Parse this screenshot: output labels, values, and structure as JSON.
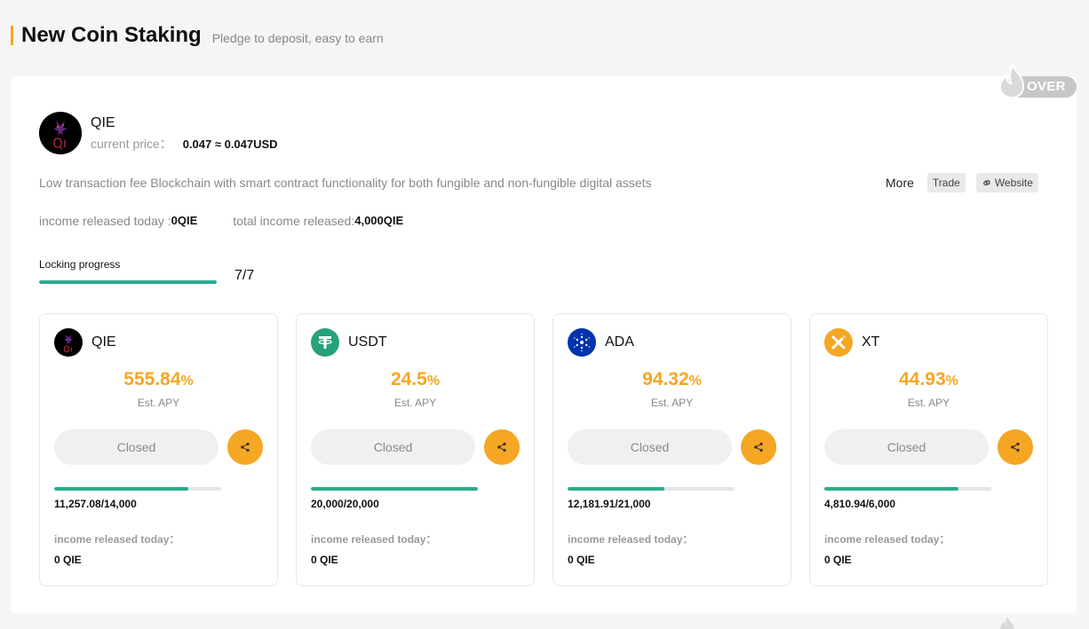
{
  "header": {
    "title": "New Coin Staking",
    "subtitle": "Pledge to deposit, easy to earn",
    "accent_color": "#f5a623"
  },
  "badge": {
    "label": "OVER",
    "icon": "flame-icon"
  },
  "coin": {
    "name": "QIE",
    "price_label": "current price：",
    "price_value": "0.047 ≈ 0.047USD",
    "description": "Low transaction fee Blockchain with smart contract functionality for both fungible and non-fungible digital assets",
    "more_label": "More",
    "trade_label": "Trade",
    "website_label": "Website",
    "income_today_label": "income released today : ",
    "income_today_value": "0QIE",
    "total_income_label": "total income released: ",
    "total_income_value": "4,000QIE"
  },
  "locking": {
    "label": "Locking progress",
    "count": "7/7",
    "progress": 1.0,
    "progress_color": "#2bab8d"
  },
  "pools": [
    {
      "name": "QIE",
      "apy": "555.84",
      "apy_unit": "%",
      "apy_label": "Est. APY",
      "button_label": "Closed",
      "progress": 0.804,
      "progress_text": "11,257.08/14,000",
      "income_label": "income released today：",
      "income_value": "0 QIE",
      "logo_color": "#000000"
    },
    {
      "name": "USDT",
      "apy": "24.5",
      "apy_unit": "%",
      "apy_label": "Est. APY",
      "button_label": "Closed",
      "progress": 1.0,
      "progress_text": "20,000/20,000",
      "income_label": "income released today：",
      "income_value": "0 QIE",
      "logo_color": "#26a17b"
    },
    {
      "name": "ADA",
      "apy": "94.32",
      "apy_unit": "%",
      "apy_label": "Est. APY",
      "button_label": "Closed",
      "progress": 0.58,
      "progress_text": "12,181.91/21,000",
      "income_label": "income released today：",
      "income_value": "0 QIE",
      "logo_color": "#0033ad"
    },
    {
      "name": "XT",
      "apy": "44.93",
      "apy_unit": "%",
      "apy_label": "Est. APY",
      "button_label": "Closed",
      "progress": 0.802,
      "progress_text": "4,810.94/6,000",
      "income_label": "income released today：",
      "income_value": "0 QIE",
      "logo_color": "#f5a623"
    }
  ]
}
